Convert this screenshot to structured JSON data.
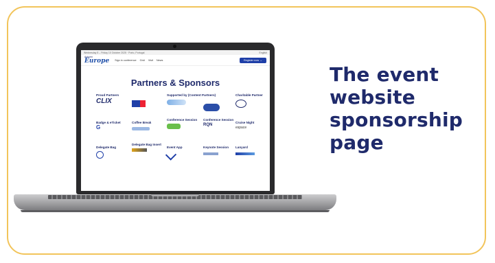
{
  "headline": "The event website sponsorship page",
  "website": {
    "topbar_left": "Wednesday 8 – Friday 10 October 2025 · Porto, Portugal",
    "topbar_right": "English",
    "logo_top": "Autumn",
    "logo_main": "Europe",
    "nav_links": [
      "Sign in conference",
      "Grid",
      "Visit",
      "News"
    ],
    "register_button": "Register now →",
    "page_title": "Partners & Sponsors",
    "sponsors": [
      {
        "label": "Proud Partners",
        "logo": "CLIX"
      },
      {
        "label": "",
        "logo": "blue-flag-logo"
      },
      {
        "label": "Supported by (Content Partners)",
        "logo": "tourism-logo"
      },
      {
        "label": "",
        "logo": "round-blue-logo"
      },
      {
        "label": "Charitable Partner",
        "logo": "charity-logo"
      },
      {
        "label": "Badge & eTicket",
        "logo": "G"
      },
      {
        "label": "Coffee Break",
        "logo": "pass-logo"
      },
      {
        "label": "Conference Session",
        "logo": "green-logo"
      },
      {
        "label": "Conference Session",
        "logo": "RQN"
      },
      {
        "label": "Cruise Night",
        "logo": "espace"
      },
      {
        "label": "Delegate Bag",
        "logo": "bag-logo"
      },
      {
        "label": "Delegate Bag Insert",
        "logo": "insert-logo"
      },
      {
        "label": "Event App",
        "logo": "app-logo"
      },
      {
        "label": "Keynote Session",
        "logo": "keynote-logo"
      },
      {
        "label": "Lanyard",
        "logo": "lanyard-logo"
      }
    ]
  },
  "colors": {
    "border": "#f2c45a",
    "headline": "#1f2a6b",
    "accent": "#1f3fa8"
  }
}
